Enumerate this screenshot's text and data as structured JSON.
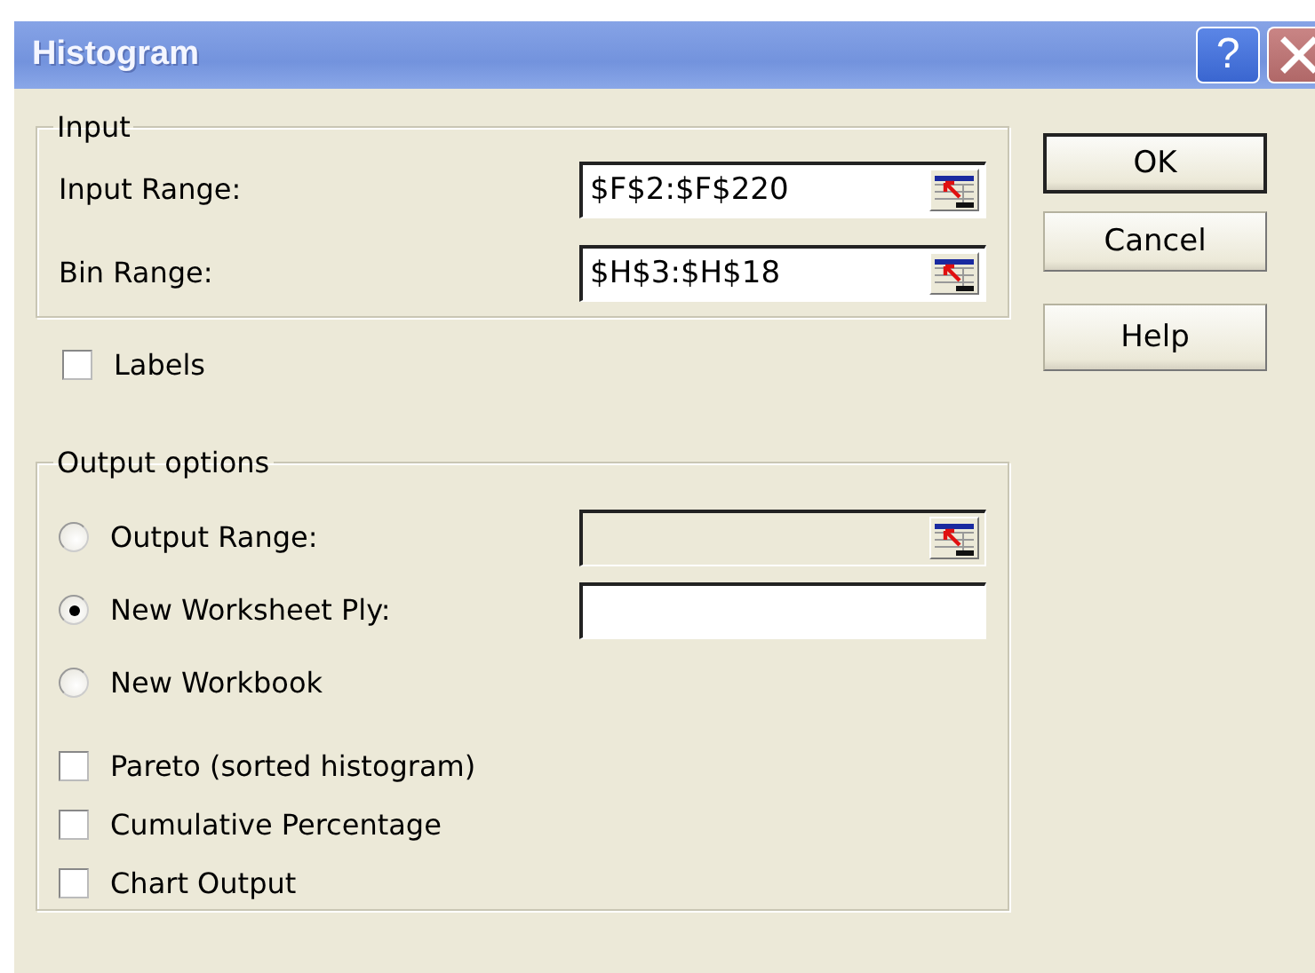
{
  "window": {
    "title": "Histogram",
    "help_glyph": "?"
  },
  "input_group": {
    "title": "Input",
    "fields": [
      {
        "label": "Input Range:",
        "value": "$F$2:$F$220",
        "disabled": false,
        "has_picker": true
      },
      {
        "label": "Bin Range:",
        "value": "$H$3:$H$18",
        "disabled": false,
        "has_picker": true
      }
    ]
  },
  "labels_checkbox": {
    "label": "Labels",
    "checked": false
  },
  "output_group": {
    "title": "Output options",
    "options": [
      {
        "kind": "radio",
        "label": "Output Range:",
        "selected": false,
        "field": {
          "disabled": true,
          "has_picker": true
        }
      },
      {
        "kind": "radio",
        "label": "New Worksheet Ply:",
        "selected": true,
        "field": {
          "disabled": false,
          "has_picker": false
        }
      },
      {
        "kind": "radio",
        "label": "New Workbook",
        "selected": false
      },
      {
        "kind": "checkbox",
        "label": "Pareto (sorted histogram)",
        "checked": false
      },
      {
        "kind": "checkbox",
        "label": "Cumulative Percentage",
        "checked": false
      },
      {
        "kind": "checkbox",
        "label": "Chart Output",
        "checked": false
      }
    ]
  },
  "buttons": [
    {
      "label": "OK",
      "default": true
    },
    {
      "label": "Cancel",
      "default": false
    },
    {
      "label": "Help",
      "default": false
    }
  ]
}
